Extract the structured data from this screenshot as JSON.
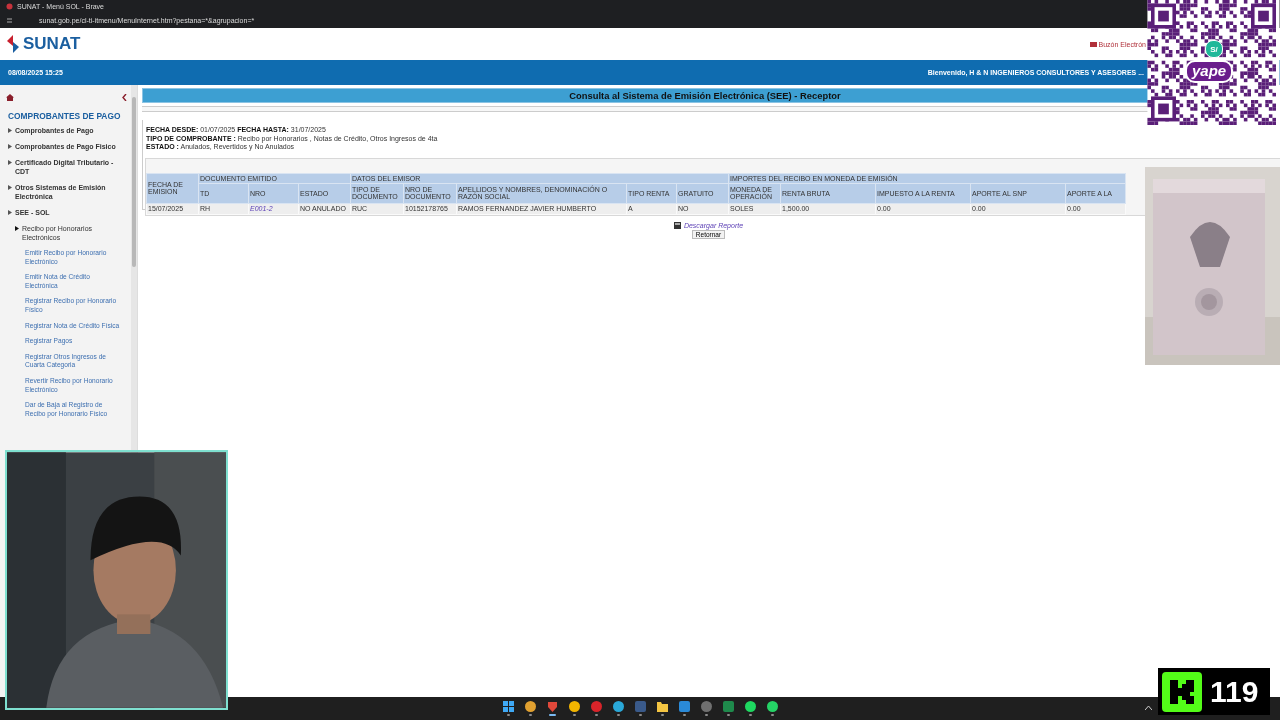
{
  "browser": {
    "title": "SUNAT - Menú SOL - Brave",
    "url": "sunat.gob.pe/cl-ti-itmenu/MenuInternet.htm?pestana=*&agrupacion=*"
  },
  "header": {
    "logo": "SUNAT",
    "mailbox_link": "Buzón Electrón",
    "datetime": "08/08/2025 15:25",
    "welcome": "Bienvenido, H & N INGENIEROS CONSULTORES Y ASESORES ..."
  },
  "sidebar": {
    "heading": "COMPROBANTES DE PAGO",
    "items": [
      {
        "label": "Comprobantes de Pago",
        "kind": "folder"
      },
      {
        "label": "Comprobantes de Pago Fisico",
        "kind": "folder"
      },
      {
        "label": "Certificado Digital Tributario - CDT",
        "kind": "folder"
      },
      {
        "label": "Otros Sistemas de Emisión Electrónica",
        "kind": "folder"
      },
      {
        "label": "SEE - SOL",
        "kind": "folder",
        "children": [
          {
            "label": "Recibo por Honorarios Electrónicos",
            "kind": "folder",
            "children": [
              {
                "label": "Emitir Recibo por Honorario Electrónico",
                "kind": "link"
              },
              {
                "label": "Emitir Nota de Crédito Electrónica",
                "kind": "link"
              },
              {
                "label": "Registrar Recibo por Honorario Físico",
                "kind": "link"
              },
              {
                "label": "Registrar Nota de Crédito Física",
                "kind": "link"
              },
              {
                "label": "Registrar Pagos",
                "kind": "link"
              },
              {
                "label": "Registrar Otros Ingresos de Cuarta Categoria",
                "kind": "link"
              },
              {
                "label": "Revertir Recibo por Honorario Electrónico",
                "kind": "link"
              },
              {
                "label": "Dar de Baja al Registro de Recibo por Honorario Físico",
                "kind": "link"
              }
            ]
          }
        ]
      }
    ]
  },
  "main": {
    "title": "Consulta al Sistema de Emisión Electrónica (SEE) - Receptor",
    "filters": [
      [
        {
          "label": "FECHA DESDE:",
          "value": "01/07/2025"
        },
        {
          "label": "FECHA HASTA:",
          "value": "31/07/2025"
        }
      ],
      [
        {
          "label": "TIPO DE COMPROBANTE :",
          "value": "Recibo por Honorarios , Notas de Crédito, Otros Ingresos de 4ta"
        }
      ],
      [
        {
          "label": "ESTADO :",
          "value": "Anulados, Revertidos y No Anulados"
        }
      ]
    ],
    "table": {
      "groups": [
        {
          "columns": [
            {
              "label": "FECHA DE EMISION",
              "kind": "text"
            }
          ]
        },
        {
          "label": "DOCUMENTO EMITIDO",
          "columns": [
            {
              "label": "TD",
              "kind": "text"
            },
            {
              "label": "NRO",
              "kind": "link"
            },
            {
              "label": "ESTADO",
              "kind": "text"
            }
          ]
        },
        {
          "label": "DATOS DEL EMISOR",
          "columns": [
            {
              "label": "TIPO DE DOCUMENTO",
              "kind": "text"
            },
            {
              "label": "NRO DE DOCUMENTO",
              "kind": "text"
            },
            {
              "label": "APELLIDOS Y NOMBRES, DENOMINACIÓN O RAZÓN SOCIAL",
              "kind": "text"
            },
            {
              "label": "TIPO RENTA",
              "kind": "text"
            },
            {
              "label": "GRATUITO",
              "kind": "text"
            }
          ]
        },
        {
          "label": "IMPORTES DEL RECIBO EN MONEDA DE EMISIÓN",
          "columns": [
            {
              "label": "MONEDA DE OPERACIÓN",
              "kind": "text"
            },
            {
              "label": "RENTA BRUTA",
              "kind": "text"
            },
            {
              "label": "IMPUESTO A LA RENTA",
              "kind": "text"
            },
            {
              "label": "APORTE AL SNP",
              "kind": "text"
            },
            {
              "label": "APORTE A LA",
              "kind": "text"
            }
          ]
        }
      ],
      "rows": [
        [
          "15/07/2025",
          "RH",
          "E001-2",
          "NO ANULADO",
          "RUC",
          "10152178765",
          "RAMOS FERNANDEZ JAVIER HUMBERTO",
          "A",
          "NO",
          "SOLES",
          "1,500.00",
          "0.00",
          "0.00",
          "0.00"
        ]
      ]
    },
    "download_link": "Descargar Reporte",
    "back_button": "Retornar"
  },
  "overlays": {
    "qr_badge": "yape",
    "qr_currency": "S/",
    "counter": "119"
  },
  "taskbar": {
    "apps": [
      {
        "kind": "grid",
        "color": "#3fa9f5",
        "selected": false
      },
      {
        "kind": "circle",
        "color": "#e0a030",
        "selected": false
      },
      {
        "kind": "shield",
        "color": "#e0483a",
        "selected": true
      },
      {
        "kind": "circle",
        "color": "#f2b400",
        "selected": false
      },
      {
        "kind": "circle",
        "color": "#d8242a",
        "selected": false
      },
      {
        "kind": "circle",
        "color": "#2aa8d8",
        "selected": false
      },
      {
        "kind": "square",
        "color": "#3a5a8a",
        "selected": false
      },
      {
        "kind": "folder",
        "color": "#f4c542",
        "selected": false
      },
      {
        "kind": "square",
        "color": "#2a8ad8",
        "selected": false
      },
      {
        "kind": "circle",
        "color": "#707070",
        "selected": false
      },
      {
        "kind": "square",
        "color": "#1f8a4c",
        "selected": false
      },
      {
        "kind": "circle",
        "color": "#1ed760",
        "selected": false
      },
      {
        "kind": "circle",
        "color": "#25d366",
        "selected": false
      }
    ]
  }
}
